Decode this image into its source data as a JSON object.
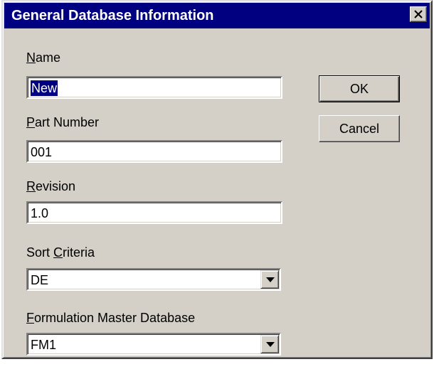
{
  "dialog": {
    "title": "General Database Information",
    "close_icon": "close-icon"
  },
  "fields": {
    "name": {
      "label_ul": "N",
      "label_rest": "ame",
      "value": "New"
    },
    "part_number": {
      "label_ul": "P",
      "label_rest": "art Number",
      "value": "001"
    },
    "revision": {
      "label_ul": "R",
      "label_rest": "evision",
      "value": "1.0"
    },
    "sort_criteria": {
      "label_pre": "Sort ",
      "label_ul": "C",
      "label_rest": "riteria",
      "value": "DE"
    },
    "formulation_master": {
      "label_ul": "F",
      "label_rest": "ormulation Master Database",
      "value": "FM1"
    }
  },
  "buttons": {
    "ok": "OK",
    "cancel": "Cancel"
  },
  "colors": {
    "title_bar": "#000080",
    "dialog_face": "#d4d0c8",
    "selection": "#000080"
  }
}
